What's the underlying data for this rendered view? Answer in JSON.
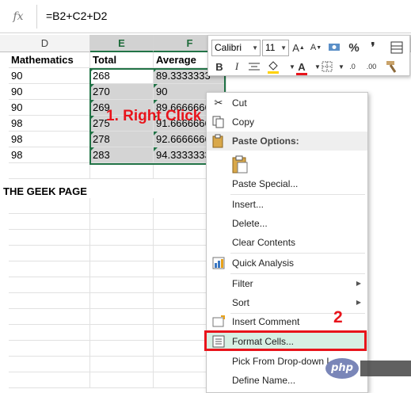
{
  "formula_bar": {
    "fx_label": "fx",
    "formula": "=B2+C2+D2"
  },
  "columns": [
    {
      "letter": "D",
      "selected": false
    },
    {
      "letter": "E",
      "selected": true
    },
    {
      "letter": "F",
      "selected": true
    }
  ],
  "headers": {
    "d": "Mathematics",
    "e": "Total",
    "f": "Average"
  },
  "rows": [
    {
      "math": "90",
      "total": "268",
      "avg": "89.3333333"
    },
    {
      "math": "90",
      "total": "270",
      "avg": "90"
    },
    {
      "math": "90",
      "total": "269",
      "avg": "89.6666666"
    },
    {
      "math": "98",
      "total": "275",
      "avg": "91.6666666"
    },
    {
      "math": "98",
      "total": "278",
      "avg": "92.6666666"
    },
    {
      "math": "98",
      "total": "283",
      "avg": "94.3333333"
    }
  ],
  "geek_text": "THE GEEK PAGE",
  "annotations": {
    "right_click": "1. Right Click",
    "step2": "2"
  },
  "mini_toolbar": {
    "font": "Calibri",
    "size": "11"
  },
  "context_menu": {
    "cut": "Cut",
    "copy": "Copy",
    "paste_options": "Paste Options:",
    "paste_special": "Paste Special...",
    "insert": "Insert...",
    "delete": "Delete...",
    "clear_contents": "Clear Contents",
    "quick_analysis": "Quick Analysis",
    "filter": "Filter",
    "sort": "Sort",
    "insert_comment": "Insert Comment",
    "format_cells": "Format Cells...",
    "pick_from_dropdown": "Pick From Drop-down L",
    "define_name": "Define Name..."
  },
  "watermark": "php",
  "colors": {
    "accent": "#217346",
    "annotation": "#e8141b",
    "highlight": "#d7efe3"
  }
}
